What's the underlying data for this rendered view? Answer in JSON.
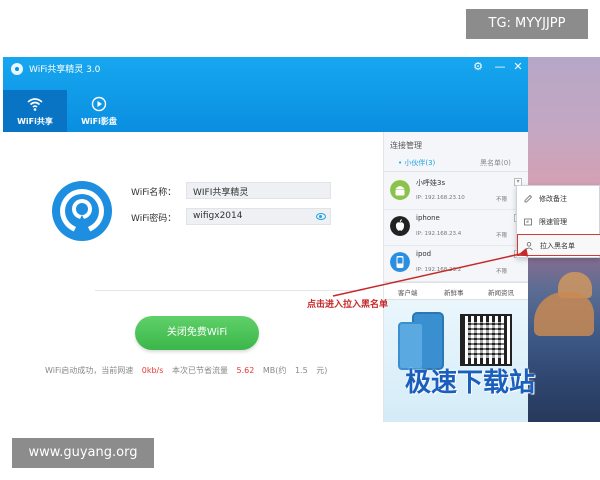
{
  "watermarks": {
    "top": "TG: MYYJJPP",
    "bottom": "www.guyang.org",
    "overlay": "极速下载站"
  },
  "window": {
    "title": "WiFi共享精灵 3.0",
    "controls": [
      "⚙",
      "—",
      "✕"
    ]
  },
  "nav": {
    "tabs": [
      {
        "label": "WiFi共享",
        "icon": "wifi-icon",
        "active": true
      },
      {
        "label": "WiFi影盘",
        "icon": "play-circle-icon",
        "active": false
      }
    ]
  },
  "main": {
    "wifi_name_label": "WiFi名称：",
    "wifi_name_value": "WIFI共享精灵",
    "wifi_password_label": "WiFi密码：",
    "wifi_password_value": "wifigx2014",
    "toggle_button": "关闭免费WiFi",
    "status": {
      "prefix": "WiFi启动成功，当前网速",
      "speed": "0kb/s",
      "saved_label": "本次已节省流量",
      "saved_value": "5.62",
      "unit_label": "MB(约",
      "money": "1.5",
      "money_unit": "元)"
    }
  },
  "side": {
    "title": "连接管理",
    "tabs": {
      "active": "• 小伙伴(3)",
      "inactive": "黑名单(0)"
    },
    "devices": [
      {
        "name": "小呼娃3s",
        "ip": "IP: 192.168.23.10",
        "limit": "不限",
        "icon": "android-icon"
      },
      {
        "name": "iphone",
        "ip": "IP: 192.168.23.4",
        "limit": "不限",
        "icon": "apple-icon"
      },
      {
        "name": "ipod",
        "ip": "IP: 192.168.23.2",
        "limit": "不限",
        "icon": "ipod-icon"
      }
    ],
    "bottom_tabs": [
      "客户端",
      "新鲜事",
      "新闻资讯"
    ]
  },
  "context_menu": {
    "items": [
      {
        "label": "修改备注",
        "icon": "edit-icon"
      },
      {
        "label": "限速管理",
        "icon": "speed-icon"
      },
      {
        "label": "拉入黑名单",
        "icon": "user-block-icon"
      }
    ]
  },
  "annotation": {
    "text": "点击进入拉入黑名单"
  },
  "colors": {
    "titlebar": "#0a8ee0",
    "accent": "#1ea0e8",
    "button": "#3bb64a",
    "highlight": "#e53935"
  }
}
